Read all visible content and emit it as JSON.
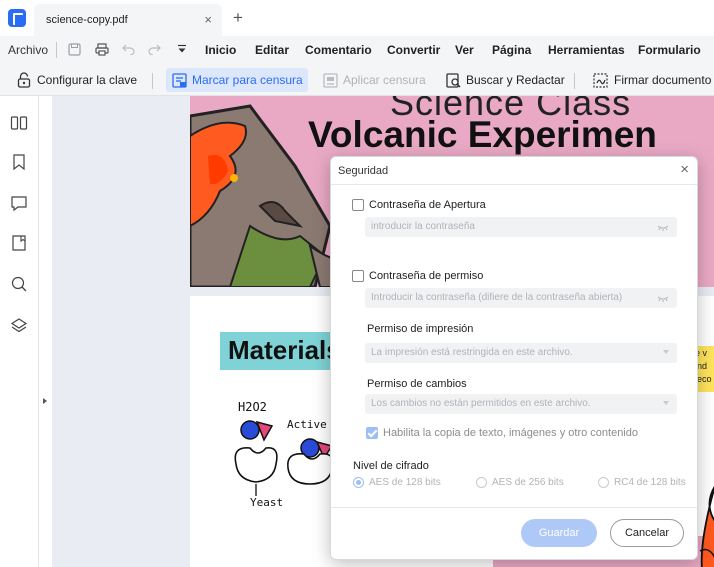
{
  "tab": {
    "title": "science-copy.pdf",
    "close": "×",
    "add": "+"
  },
  "menu": {
    "archivo": "Archivo",
    "items": [
      "Inicio",
      "Editar",
      "Comentario",
      "Convertir",
      "Ver",
      "Página",
      "Herramientas",
      "Formulario"
    ]
  },
  "toolbar": {
    "configurar": "Configurar la clave",
    "marcar": "Marcar para censura",
    "aplicar": "Aplicar censura",
    "buscar": "Buscar y Redactar",
    "firmar": "Firmar documento"
  },
  "document": {
    "top_fragment": "Science Class",
    "title": "Volcanic Experimen",
    "materials": "Materials",
    "note_lines": [
      "re v",
      "and",
      "deco"
    ],
    "sketch_labels": {
      "h2o2": "H2O2",
      "active": "Active Si",
      "yeast": "Yeast"
    }
  },
  "dialog": {
    "title": "Seguridad",
    "close": "×",
    "open_password_label": "Contraseña de Apertura",
    "open_password_placeholder": "introducir la contraseña",
    "permission_password_label": "Contraseña de permiso",
    "permission_password_placeholder": "Introducir la contraseña (difiere de la contraseña abierta)",
    "print_permission_label": "Permiso de impresión",
    "print_permission_value": "La impresión está restringida en este archivo.",
    "change_permission_label": "Permiso de cambios",
    "change_permission_value": "Los cambios no están permitidos en este archivo.",
    "copy_label": "Habilita la copia de texto, imágenes y otro contenido",
    "encryption_label": "Nivel de cifrado",
    "encryption_options": [
      "AES de 128 bits",
      "AES de 256 bits",
      "RC4 de 128 bits"
    ],
    "save": "Guardar",
    "cancel": "Cancelar"
  },
  "colors": {
    "accent": "#2a6df4",
    "page_pink": "#e9a9c5",
    "materials_banner": "#7fd3d6"
  }
}
